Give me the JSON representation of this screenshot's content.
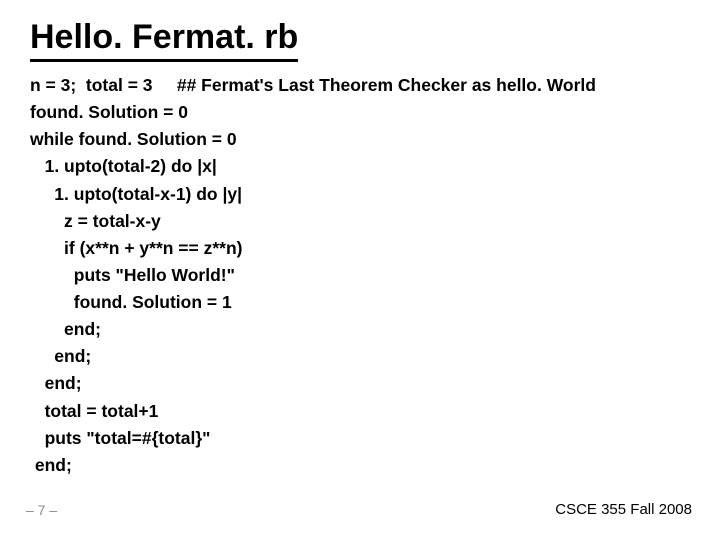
{
  "title": "Hello. Fermat. rb",
  "code_lines": [
    "n = 3;  total = 3     ## Fermat's Last Theorem Checker as hello. World",
    "found. Solution = 0",
    "while found. Solution = 0",
    "   1. upto(total-2) do |x|",
    "     1. upto(total-x-1) do |y|",
    "       z = total-x-y",
    "       if (x**n + y**n == z**n)",
    "         puts \"Hello World!\"",
    "         found. Solution = 1",
    "       end;",
    "     end;",
    "   end;",
    "   total = total+1",
    "   puts \"total=#{total}\"",
    " end;"
  ],
  "footer": {
    "left_number": "– 7 –",
    "right_text": "CSCE 355 Fall 2008"
  }
}
